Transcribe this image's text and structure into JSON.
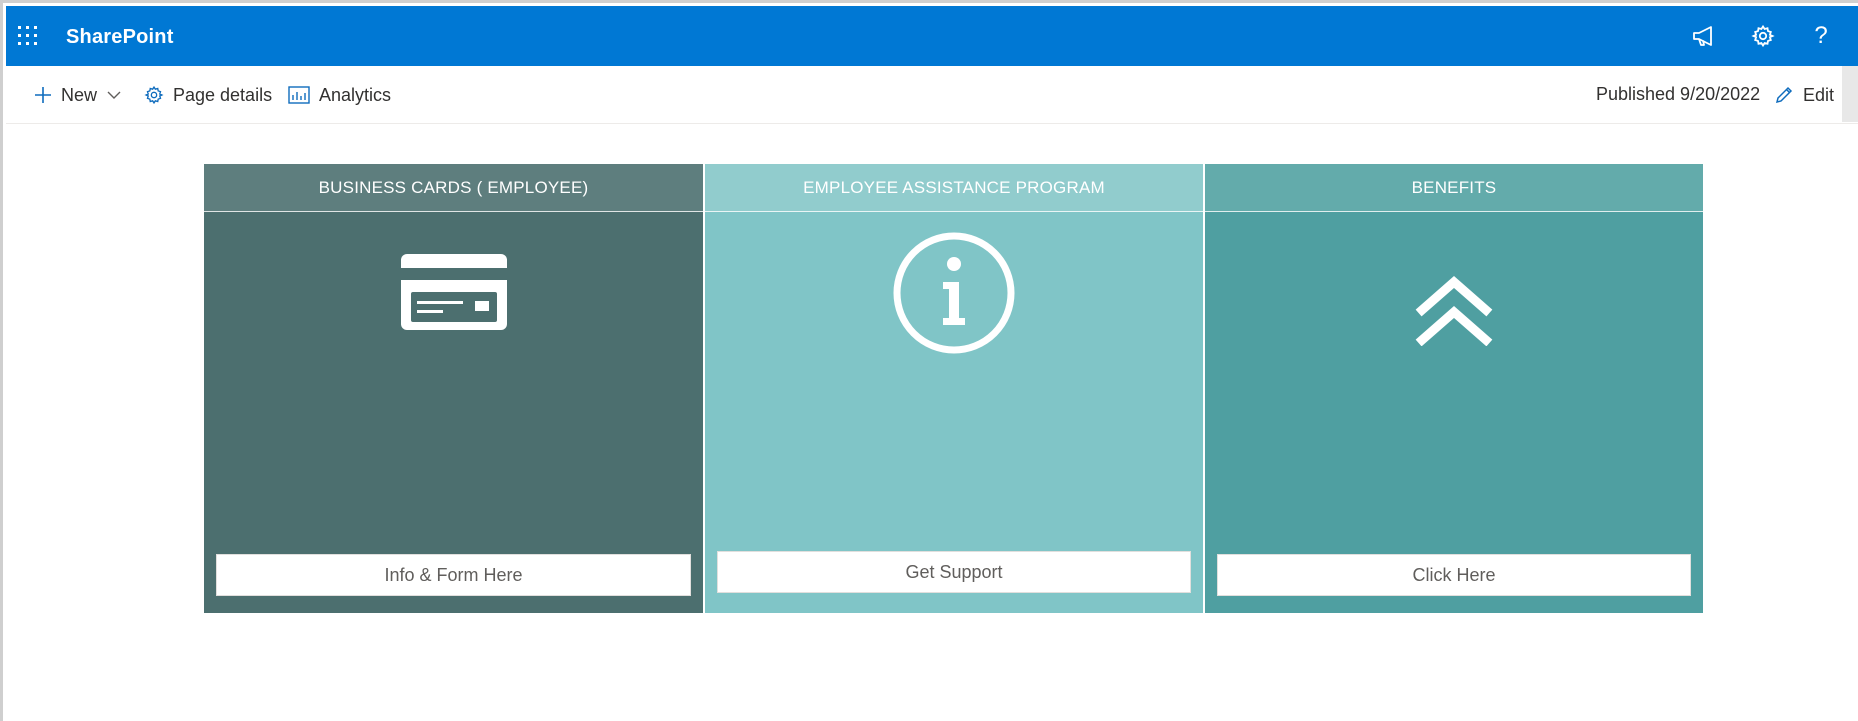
{
  "suite_bar": {
    "app_name": "SharePoint",
    "icons": [
      "waffle-icon",
      "megaphone-icon",
      "gear-icon",
      "help-icon"
    ],
    "help_glyph": "?",
    "background_color": "#0078d4"
  },
  "command_bar": {
    "new_label": "New",
    "page_details_label": "Page details",
    "analytics_label": "Analytics",
    "published_text": "Published 9/20/2022",
    "edit_label": "Edit"
  },
  "tiles": [
    {
      "header": "BUSINESS CARDS ( EMPLOYEE)",
      "icon": "credit-card-icon",
      "button_label": "Info & Form Here",
      "color": "#4c6f6f"
    },
    {
      "header": "EMPLOYEE ASSISTANCE PROGRAM",
      "icon": "info-icon",
      "button_label": "Get Support",
      "color": "#80c5c7"
    },
    {
      "header": "BENEFITS",
      "icon": "double-chevron-up-icon",
      "button_label": "Click Here",
      "color": "#4f9fa1"
    }
  ]
}
